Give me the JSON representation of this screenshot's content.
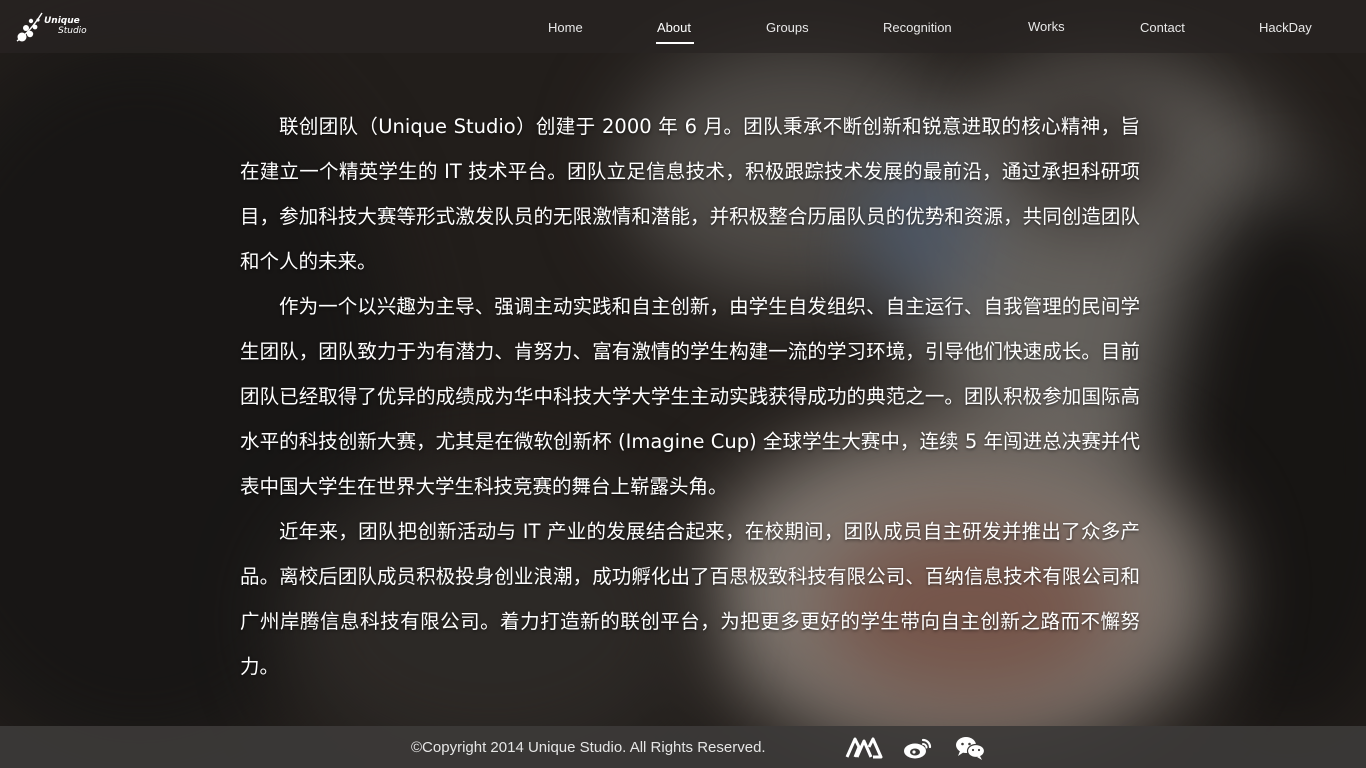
{
  "brand": {
    "line1": "Unique",
    "line2": "Studio",
    "logo_icon": "unique-studio-logo-icon"
  },
  "nav": {
    "items": [
      {
        "label": "Home",
        "active": false
      },
      {
        "label": "About",
        "active": true
      },
      {
        "label": "Groups",
        "active": false
      },
      {
        "label": "Recognition",
        "active": false
      },
      {
        "label": "Works",
        "active": false
      },
      {
        "label": "Contact",
        "active": false
      },
      {
        "label": "HackDay",
        "active": false
      }
    ]
  },
  "about": {
    "paragraphs": [
      "联创团队（Unique Studio）创建于 2000 年 6 月。团队秉承不断创新和锐意进取的核心精神，旨在建立一个精英学生的 IT 技术平台。团队立足信息技术，积极跟踪技术发展的最前沿，通过承担科研项目，参加科技大赛等形式激发队员的无限激情和潜能，并积极整合历届队员的优势和资源，共同创造团队和个人的未来。",
      "作为一个以兴趣为主导、强调主动实践和自主创新，由学生自发组织、自主运行、自我管理的民间学生团队，团队致力于为有潜力、肯努力、富有激情的学生构建一流的学习环境，引导他们快速成长。目前团队已经取得了优异的成绩成为华中科技大学大学生主动实践获得成功的典范之一。团队积极参加国际高水平的科技创新大赛，尤其是在微软创新杯 (Imagine Cup) 全球学生大赛中，连续 5 年闯进总决赛并代表中国大学生在世界大学生科技竞赛的舞台上崭露头角。",
      "近年来，团队把创新活动与 IT 产业的发展结合起来，在校期间，团队成员自主研发并推出了众多产品。离校后团队成员积极投身创业浪潮，成功孵化出了百思极致科技有限公司、百纳信息技术有限公司和广州岸腾信息科技有限公司。着力打造新的联创平台，为把更多更好的学生带向自主创新之路而不懈努力。"
    ]
  },
  "footer": {
    "copyright": "©Copyright 2014 Unique Studio. All Rights Reserved.",
    "social": [
      "renren-icon",
      "weibo-icon",
      "wechat-icon"
    ]
  }
}
